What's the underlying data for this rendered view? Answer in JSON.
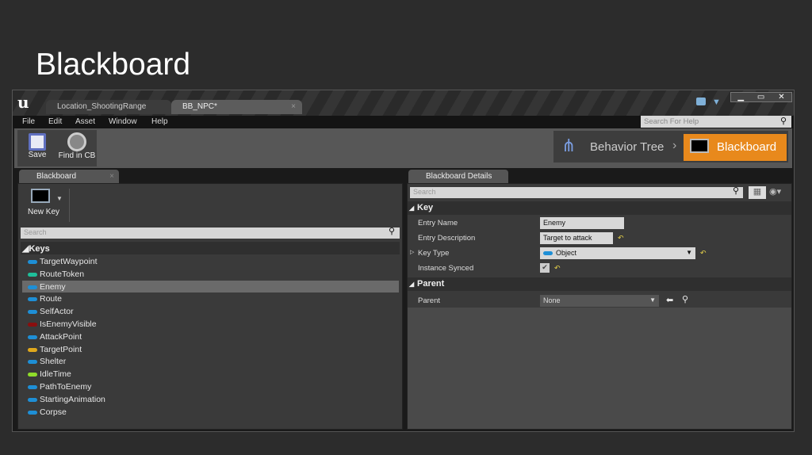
{
  "slide_title": "Blackboard",
  "tabs": [
    "Location_ShootingRange",
    "BB_NPC*"
  ],
  "menu": [
    "File",
    "Edit",
    "Asset",
    "Window",
    "Help"
  ],
  "help_search_placeholder": "Search For Help",
  "toolbar": {
    "save": "Save",
    "find": "Find in CB"
  },
  "modes": {
    "behavior_tree": "Behavior Tree",
    "blackboard": "Blackboard"
  },
  "left_panel": {
    "tab": "Blackboard",
    "new_key": "New Key",
    "search_placeholder": "Search",
    "keys_header": "Keys",
    "keys": [
      {
        "name": "TargetWaypoint",
        "color": "#1e8fd6"
      },
      {
        "name": "RouteToken",
        "color": "#1ebf9a"
      },
      {
        "name": "Enemy",
        "color": "#1e8fd6",
        "selected": true
      },
      {
        "name": "Route",
        "color": "#1e8fd6"
      },
      {
        "name": "SelfActor",
        "color": "#1e8fd6"
      },
      {
        "name": "IsEnemyVisible",
        "color": "#8a0e0e"
      },
      {
        "name": "AttackPoint",
        "color": "#1e8fd6"
      },
      {
        "name": "TargetPoint",
        "color": "#e0a81c"
      },
      {
        "name": "Shelter",
        "color": "#1e8fd6"
      },
      {
        "name": "IdleTime",
        "color": "#8fdc2a"
      },
      {
        "name": "PathToEnemy",
        "color": "#1e8fd6"
      },
      {
        "name": "StartingAnimation",
        "color": "#1e8fd6"
      },
      {
        "name": "Corpse",
        "color": "#1e8fd6"
      }
    ]
  },
  "details": {
    "tab": "Blackboard Details",
    "search_placeholder": "Search",
    "key_section": "Key",
    "entry_name_label": "Entry Name",
    "entry_name": "Enemy",
    "entry_desc_label": "Entry Description",
    "entry_desc": "Target to attack",
    "key_type_label": "Key Type",
    "key_type": "Object",
    "instance_synced_label": "Instance Synced",
    "instance_synced": true,
    "parent_section": "Parent",
    "parent_label": "Parent",
    "parent_value": "None"
  },
  "accent": "#e8891c"
}
